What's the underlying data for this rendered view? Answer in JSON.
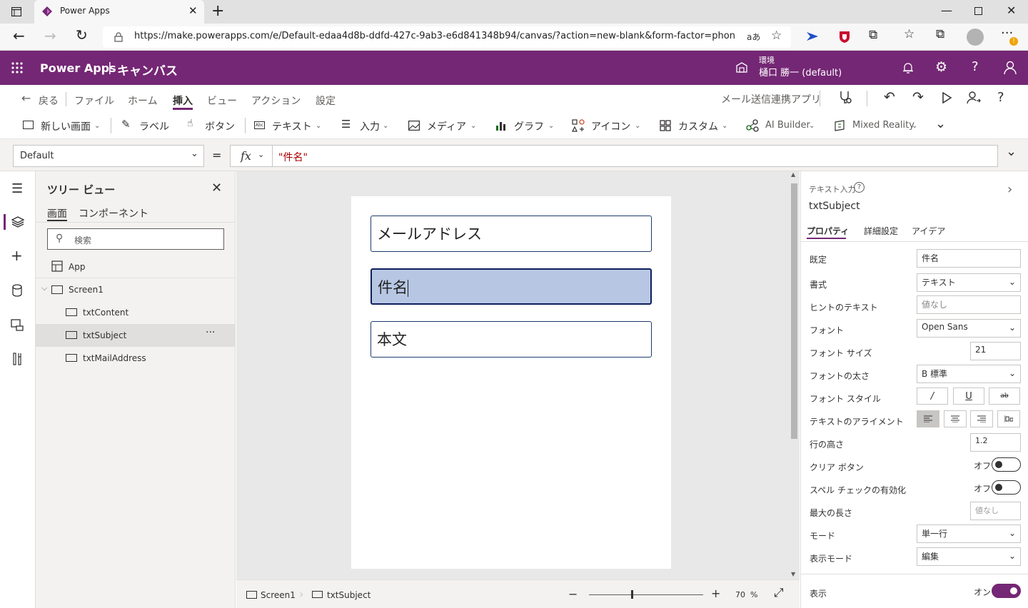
{
  "browser": {
    "tab_title": "Power Apps",
    "url": "https://make.powerapps.com/e/Default-edaa4d8b-ddfd-427c-9ab3-e6d841348b94/canvas/?action=new-blank&form-factor=phone&...",
    "read_aloud": "aあ"
  },
  "appbar": {
    "brand": "Power Apps",
    "separator": "|",
    "context": "キャンバス",
    "env_label": "環境",
    "env_name": "樋口 勝一 (default)"
  },
  "cmdbar": {
    "back": "戻る",
    "menus": [
      "ファイル",
      "ホーム",
      "挿入",
      "ビュー",
      "アクション",
      "設定"
    ],
    "app_name": "メール送信連携アプリ"
  },
  "ribbon": {
    "new_screen": "新しい画面",
    "label": "ラベル",
    "button": "ボタン",
    "text": "テキスト",
    "input": "入力",
    "media": "メディア",
    "chart": "グラフ",
    "icon": "アイコン",
    "custom": "カスタム",
    "ai_builder": "AI Builder",
    "mixed_reality": "Mixed Reality"
  },
  "formula": {
    "property": "Default",
    "equals": "=",
    "fx": "fx",
    "value": "\"件名\""
  },
  "tree": {
    "title": "ツリー ビュー",
    "tab_screens": "画面",
    "tab_components": "コンポーネント",
    "search_placeholder": "検索",
    "app": "App",
    "screen": "Screen1",
    "items": [
      "txtContent",
      "txtSubject",
      "txtMailAddress"
    ],
    "more": "···"
  },
  "canvas": {
    "controls": [
      "メールアドレス",
      "件名",
      "本文"
    ],
    "footer_screen": "Screen1",
    "footer_control": "txtSubject",
    "zoom_minus": "−",
    "zoom_plus": "+",
    "zoom": "70",
    "zoom_unit": "%"
  },
  "props": {
    "type": "テキスト入力",
    "name": "txtSubject",
    "tabs": [
      "プロパティ",
      "詳細設定",
      "アイデア"
    ],
    "default_label": "既定",
    "default_value": "件名",
    "format_label": "書式",
    "format_value": "テキスト",
    "hint_label": "ヒントのテキスト",
    "hint_value": "値なし",
    "font_label": "フォント",
    "font_value": "Open Sans",
    "size_label": "フォント サイズ",
    "size_value": "21",
    "weight_label": "フォントの太さ",
    "weight_value": "B 標準",
    "style_label": "フォント スタイル",
    "style_italic": "/",
    "style_underline": "U",
    "style_strike": "ab",
    "align_label": "テキストのアライメント",
    "lineheight_label": "行の高さ",
    "lineheight_value": "1.2",
    "clear_label": "クリア ボタン",
    "clear_value": "オフ",
    "spell_label": "スペル チェックの有効化",
    "spell_value": "オフ",
    "maxlen_label": "最大の長さ",
    "maxlen_value": "値なし",
    "mode_label": "モード",
    "mode_value": "単一行",
    "display_label": "表示モード",
    "display_value": "編集",
    "visible_label": "表示",
    "visible_value": "オン"
  },
  "colors": {
    "brand": "#742774",
    "selection": "#b7c7e3",
    "control_border": "#1e3a6e"
  }
}
